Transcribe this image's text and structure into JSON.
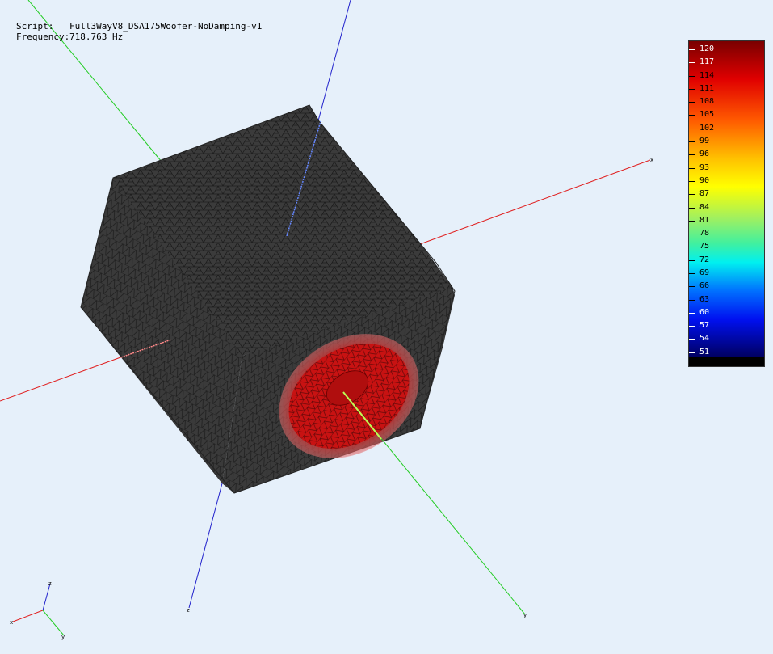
{
  "info": {
    "script_label": "Script:",
    "script_value": "Full3WayV8_DSA175Woofer-NoDamping-v1",
    "freq_label": "Frequency:",
    "freq_value": "718.763 Hz"
  },
  "legend": {
    "ticks": [
      "120",
      "117",
      "114",
      "111",
      "108",
      "105",
      "102",
      "99",
      "96",
      "93",
      "90",
      "87",
      "84",
      "81",
      "78",
      "75",
      "72",
      "69",
      "66",
      "63",
      "60",
      "57",
      "54",
      "51"
    ]
  },
  "axis_labels": {
    "x": "x",
    "y": "y",
    "z": "z"
  },
  "colors": {
    "background": "#e6f0fa",
    "x_axis": "#e02020",
    "y_axis": "#20d020",
    "z_axis": "#2020d0",
    "mesh_face": "#3a3a3a",
    "driver": "#c41010"
  }
}
